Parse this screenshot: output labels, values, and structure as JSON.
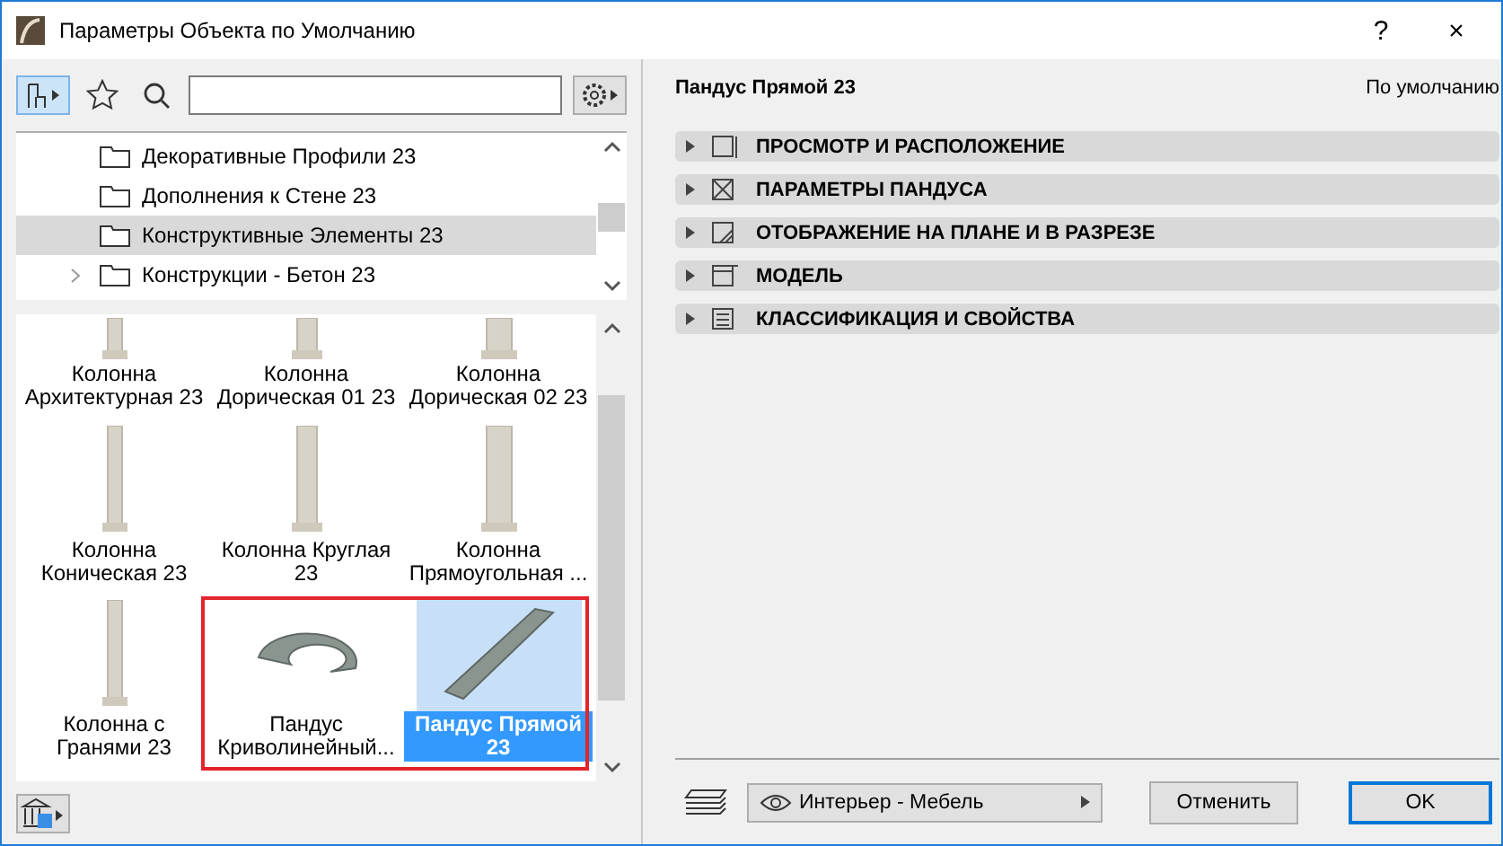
{
  "window": {
    "title": "Параметры Объекта по Умолчанию",
    "help": "?",
    "close": "×"
  },
  "tree": [
    {
      "label": "Декоративные Профили 23",
      "selected": false,
      "expandable": false
    },
    {
      "label": "Дополнения к Стене 23",
      "selected": false,
      "expandable": false
    },
    {
      "label": "Конструктивные Элементы 23",
      "selected": true,
      "expandable": false
    },
    {
      "label": "Конструкции - Бетон 23",
      "selected": false,
      "expandable": true
    }
  ],
  "objects": [
    {
      "label": "Колонна Архитектурная 23",
      "kind": "column",
      "selected": false
    },
    {
      "label": "Колонна Дорическая 01 23",
      "kind": "column",
      "selected": false
    },
    {
      "label": "Колонна Дорическая 02 23",
      "kind": "column",
      "selected": false
    },
    {
      "label": "Колонна Коническая 23",
      "kind": "column",
      "selected": false
    },
    {
      "label": "Колонна Круглая 23",
      "kind": "column",
      "selected": false
    },
    {
      "label": "Колонна Прямоугольная ...",
      "kind": "column",
      "selected": false
    },
    {
      "label": "Колонна с Гранями 23",
      "kind": "column",
      "selected": false
    },
    {
      "label": "Пандус Криволинейный...",
      "kind": "curved-ramp",
      "selected": false
    },
    {
      "label": "Пандус Прямой 23",
      "kind": "straight-ramp",
      "selected": true
    }
  ],
  "details": {
    "title": "Пандус Прямой 23",
    "status": "По умолчанию",
    "sections": [
      {
        "label": "ПРОСМОТР И РАСПОЛОЖЕНИЕ",
        "expanded": false
      },
      {
        "label": "ПАРАМЕТРЫ ПАНДУСА",
        "expanded": false
      },
      {
        "label": "ОТОБРАЖЕНИЕ НА ПЛАНЕ И В РАЗРЕЗЕ",
        "expanded": false
      },
      {
        "label": "МОДЕЛЬ",
        "expanded": false
      },
      {
        "label": "КЛАССИФИКАЦИЯ И СВОЙСТВА",
        "expanded": false
      }
    ]
  },
  "footer": {
    "layer": "Интерьер - Мебель",
    "buttons": [
      "Отменить",
      "OK"
    ]
  }
}
